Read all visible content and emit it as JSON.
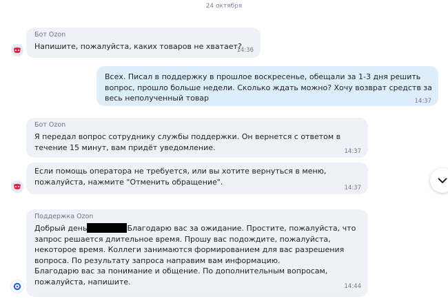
{
  "date_separator": "24 октября",
  "messages": [
    {
      "sender": "Бот Ozon",
      "lines": [
        "Напишите, пожалуйста, каких товаров не хватает?"
      ],
      "time": "14:36"
    },
    {
      "lines": [
        "Всех. Писал в поддержку в прошлое воскресенье, обещали за 1-3 дня решить",
        "вопрос, прошло больше недели. Сколько ждать можно? Хочу возврат средств за",
        "весь неполученный товар"
      ],
      "time": "14:37"
    },
    {
      "sender": "Бот Ozon",
      "lines": [
        "Я передал вопрос сотруднику службы поддержки. Он вернется с ответом в",
        "течение 15 минут, вам придёт уведомление."
      ],
      "time": "14:37"
    },
    {
      "lines": [
        "Если помощь оператора не требуется, или вы хотите вернуться в меню,",
        "пожалуйста, нажмите \"Отменить обращение\"."
      ],
      "time": "14:37"
    },
    {
      "sender": "Поддержка Ozon",
      "line1_before": "Добрый день",
      "line1_after": "Благодарю вас за ожидание. Простите, пожалуйста, что",
      "lines": [
        "запрос решается длительное время. Прошу вас подождите, пожалуйста,",
        "некоторое время. Коллеги занимаются формированием для вас разрешения",
        "вопроса. По результату запроса направим вам информацию.",
        "Благодарю вас за понимание и общение. По дополнительным вопросам,",
        "пожалуйста, напишите."
      ],
      "time": "14:44"
    }
  ],
  "icons": {
    "bot_avatar": "ozon-bot-icon",
    "support_avatar": "ozon-support-icon",
    "scroll_down": "chevron-down-icon"
  },
  "colors": {
    "incoming_bubble": "#eef1f6",
    "outgoing_bubble": "#deedfa",
    "bot_icon": "#e0203d",
    "support_icon": "#005bff"
  }
}
